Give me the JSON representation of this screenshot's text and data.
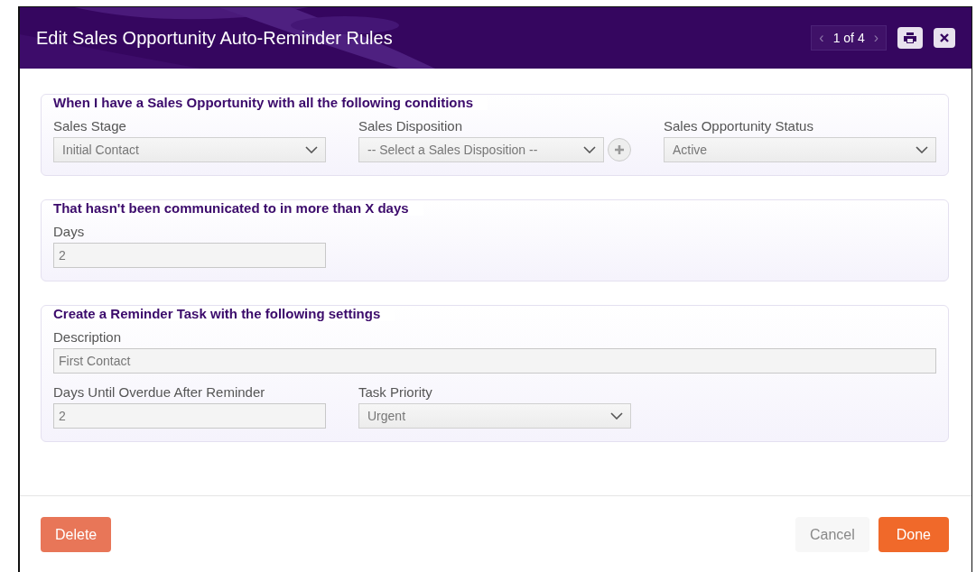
{
  "dialog": {
    "title": "Edit Sales Opportunity Auto-Reminder Rules",
    "pager": {
      "prev": "‹",
      "position": "1 of 4",
      "next": "›"
    }
  },
  "sections": [
    {
      "legend": "When I have a Sales Opportunity with all the following conditions",
      "rows": [
        [
          {
            "label": "Sales Stage",
            "kind": "select",
            "value": "Initial Contact"
          },
          {
            "label": "Sales Disposition",
            "kind": "select_with_add",
            "value": "-- Select a Sales Disposition --"
          },
          {
            "label": "Sales Opportunity Status",
            "kind": "select",
            "value": "Active"
          }
        ]
      ]
    },
    {
      "legend": "That hasn't been communicated to in more than X days",
      "rows": [
        [
          {
            "label": "Days",
            "kind": "text",
            "value": "2"
          }
        ]
      ]
    },
    {
      "legend": "Create a Reminder Task with the following settings",
      "rows": [
        [
          {
            "label": "Description",
            "kind": "wide_text",
            "value": "First Contact"
          }
        ],
        [
          {
            "label": "Days Until Overdue After Reminder",
            "kind": "text",
            "value": "2"
          },
          {
            "label": "Task Priority",
            "kind": "select",
            "value": "Urgent"
          }
        ]
      ]
    }
  ],
  "footer": {
    "delete": "Delete",
    "cancel": "Cancel",
    "done": "Done"
  }
}
